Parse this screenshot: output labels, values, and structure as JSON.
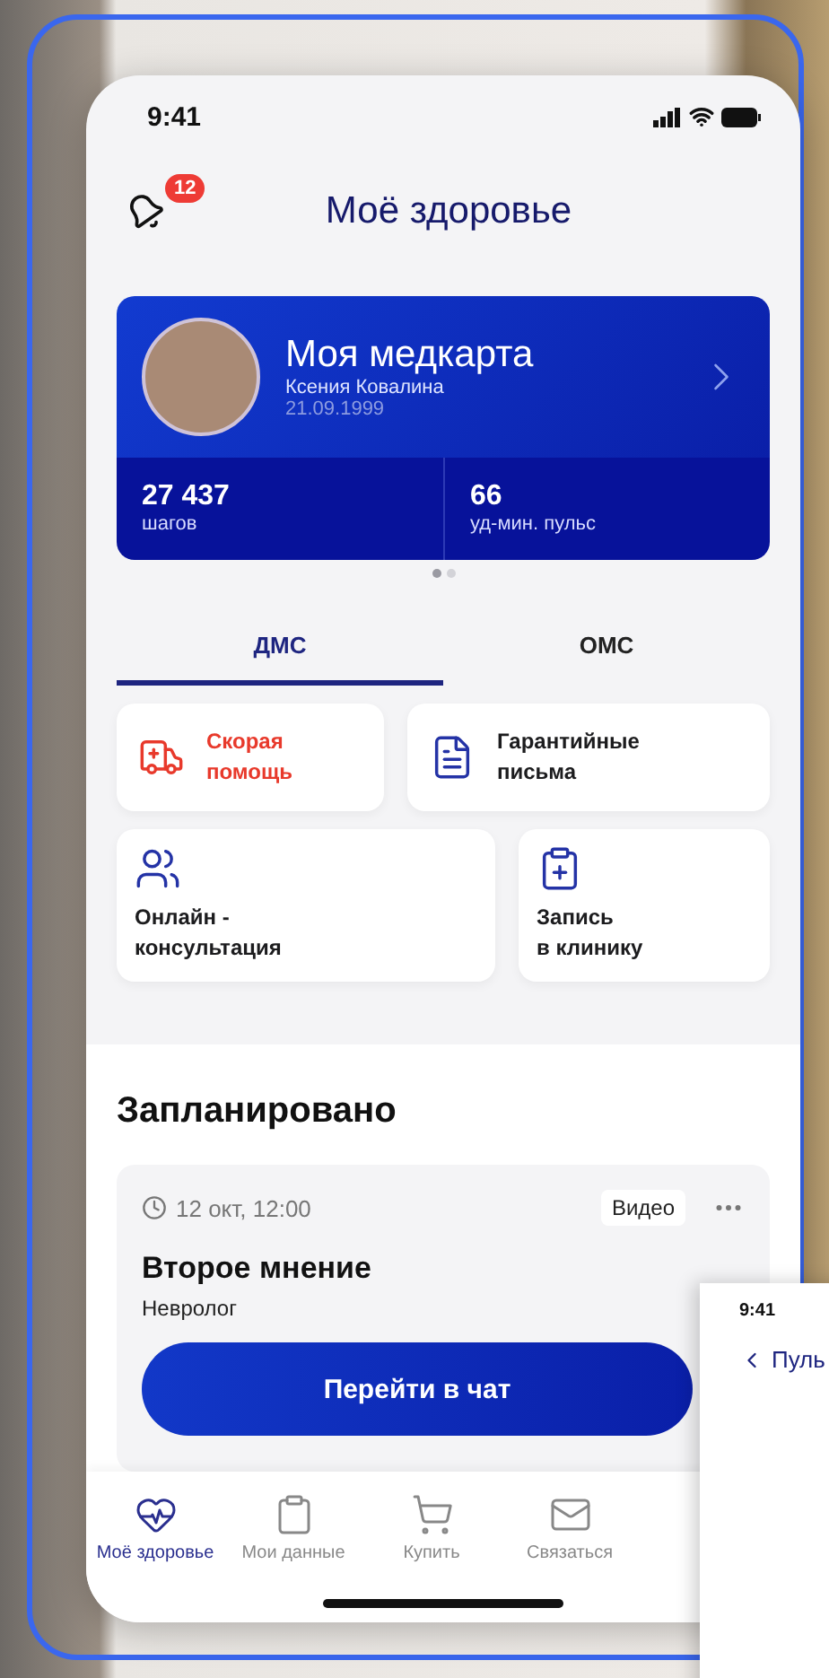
{
  "status_bar": {
    "time": "9:41"
  },
  "header": {
    "title": "Моё здоровье",
    "notifications_badge": "12"
  },
  "medcard": {
    "title": "Моя медкарта",
    "name": "Ксения Ковалина",
    "birth_date": "21.09.1999",
    "stats": [
      {
        "value": "27 437",
        "label": "шагов"
      },
      {
        "value": "66",
        "label": "уд-мин. пульс"
      }
    ]
  },
  "pager": [
    {
      "selected": true
    },
    {
      "selected": false
    }
  ],
  "tabs": [
    {
      "label": "ДМС",
      "selected": true
    },
    {
      "label": "ОМС",
      "selected": false
    }
  ],
  "tile_rows": [
    [
      {
        "kind": "ambulance",
        "label": "Скорая\nпомощь",
        "color": "#e8392b"
      },
      {
        "kind": "letter",
        "label": "Гарантийные\nписьма",
        "color": "#1c1c1e"
      }
    ],
    [
      {
        "kind": "people",
        "label": "Онлайн -\nконсультация",
        "color": "#1c1c1e"
      },
      {
        "kind": "clipboard",
        "label": "Запись\nв клинику",
        "color": "#1c1c1e"
      }
    ]
  ],
  "scheduled": {
    "title": "Запланировано",
    "appointments": [
      {
        "time": "12 окт, 12:00",
        "type": "Видео",
        "title": "Второе мнение",
        "specialist": "Невролог",
        "action": "Перейти в чат"
      }
    ]
  },
  "tab_bar": [
    {
      "kind": "heart",
      "label": "Моё здоровье",
      "selected": true
    },
    {
      "kind": "clipboard",
      "label": "Мои данные",
      "selected": false
    },
    {
      "kind": "cart",
      "label": "Купить",
      "selected": false
    },
    {
      "kind": "contact",
      "label": "Связаться",
      "selected": false
    }
  ],
  "second_screen": {
    "time": "9:41",
    "title": "Пуль"
  }
}
